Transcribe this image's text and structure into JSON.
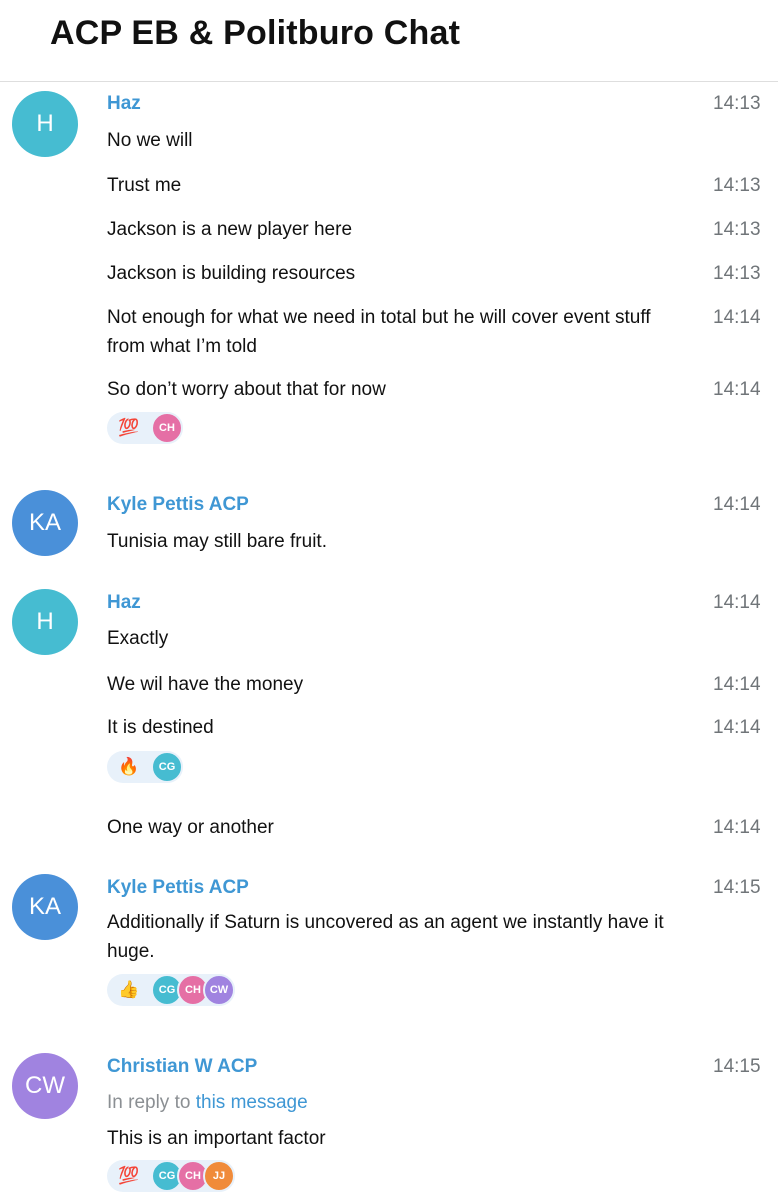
{
  "chat": {
    "title": "ACP EB & Politburo Chat"
  },
  "colors": {
    "haz": "#46bcd1",
    "kyle": "#4a90d9",
    "christian": "#a083e0",
    "ch": "#e56fa5",
    "cg": "#46bcd1",
    "cw": "#a083e0",
    "jj": "#f08b3a",
    "name": "#3f97d4"
  },
  "messages": {
    "m1": {
      "avatar": "H",
      "sender": "Haz",
      "time": "14:13",
      "text": "No we will"
    },
    "m2": {
      "text": "Trust me",
      "time": "14:13"
    },
    "m3": {
      "text": "Jackson is a new player here",
      "time": "14:13"
    },
    "m4": {
      "text": "Jackson is building resources",
      "time": "14:13"
    },
    "m5": {
      "text1": "Not enough for what we need in total but he will cover event stuff",
      "text2": "from what I’m told",
      "time": "14:14"
    },
    "m6": {
      "text": "So don’t worry about that for now",
      "time": "14:14",
      "reaction_emoji": "💯",
      "reactors": [
        "CH"
      ]
    },
    "m7": {
      "avatar": "KA",
      "sender": "Kyle Pettis ACP",
      "time": "14:14",
      "text": "Tunisia may still bare fruit."
    },
    "m8": {
      "avatar": "H",
      "sender": "Haz",
      "time": "14:14",
      "text": "Exactly"
    },
    "m9": {
      "text": "We wil have the money",
      "time": "14:14"
    },
    "m10": {
      "text": "It is destined",
      "time": "14:14",
      "reaction_emoji": "🔥",
      "reactors": [
        "CG"
      ]
    },
    "m11": {
      "text": "One way or another",
      "time": "14:14"
    },
    "m12": {
      "avatar": "KA",
      "sender": "Kyle Pettis ACP",
      "time": "14:15",
      "text1": "Additionally if Saturn is uncovered as an agent we instantly have it",
      "text2": "huge.",
      "reaction_emoji": "👍",
      "reactors": [
        "CG",
        "CH",
        "CW"
      ]
    },
    "m13": {
      "avatar": "CW",
      "sender": "Christian W ACP",
      "time": "14:15",
      "reply_prefix": "In reply to",
      "reply_link": "this message",
      "text": "This is an important factor",
      "reaction_emoji": "💯",
      "reactors": [
        "CG",
        "CH",
        "JJ"
      ]
    }
  }
}
